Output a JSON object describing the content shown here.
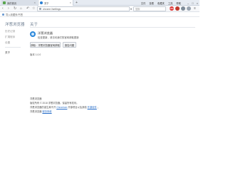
{
  "tabs": [
    {
      "label": "我的首页",
      "icon": "home-page-icon"
    },
    {
      "label": "关于",
      "icon": "browser-logo-icon"
    }
  ],
  "new_tab_label": "+",
  "menu": [
    "文件",
    "查看",
    "收藏夹",
    "工具",
    "帮助"
  ],
  "window_controls": {
    "minimize": "–",
    "maximize": "□",
    "close": "×"
  },
  "toolbar": {
    "url": "chrome://settings",
    "search_placeholder": "搜索",
    "badge_label": "ABP"
  },
  "favorites": {
    "item": "导入收藏夹/书签"
  },
  "sidebar": {
    "title": "洋葱浏览器",
    "items": [
      "历史记录",
      "扩展程序",
      "设置",
      "关于"
    ]
  },
  "about": {
    "title": "关于",
    "product_name": "洋葱浏览器",
    "update_status": "检查更新，请访问我们的官网获取更新",
    "buttons": [
      "获取：洋葱浏览器官网获取",
      "报告问题"
    ],
    "version": "版本 1.0.0"
  },
  "footer": {
    "line1": "洋葱浏览器",
    "line2": "版权所有 © 2018 洋葱浏览器。保留所有权利。",
    "line3_prefix": "洋葱浏览器的诞生离不开",
    "line3_link1": "Chromium",
    "line3_middle": "开源项目以及其他",
    "line3_link2": "开源软件",
    "line3_suffix": "。",
    "line4_prefix": "洋葱浏览器",
    "line4_link": "服务条款"
  },
  "colors": {
    "accent": "#2a86d9",
    "link": "#2a6fc9",
    "heading": "#6f7f92"
  }
}
